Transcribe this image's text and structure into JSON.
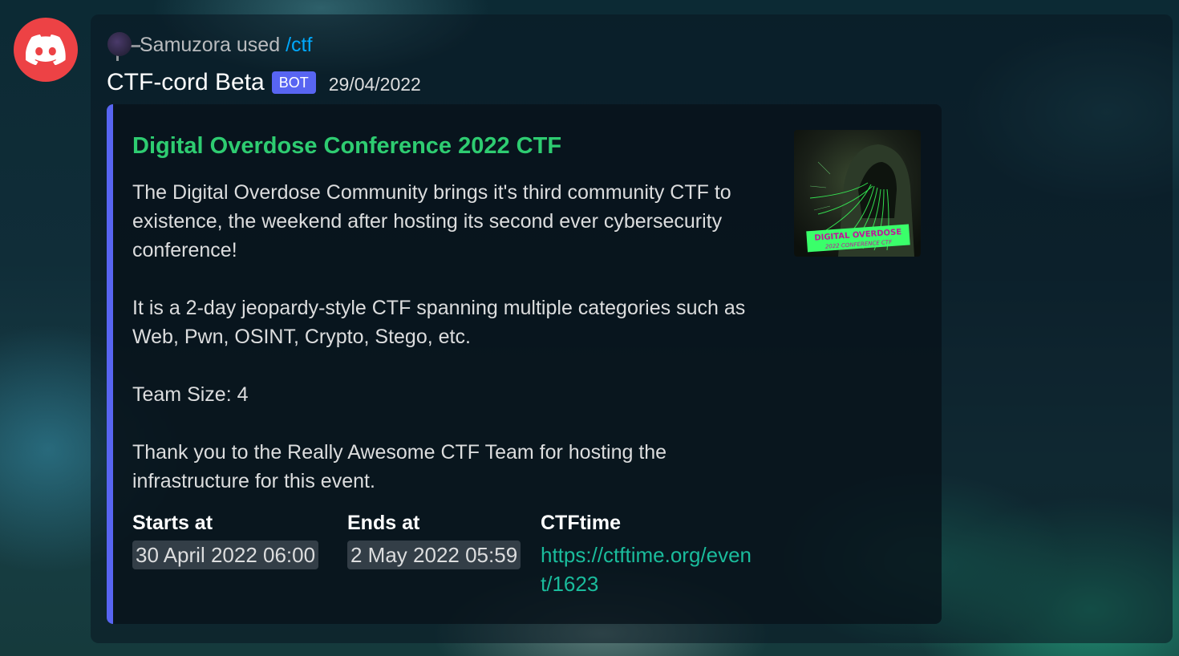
{
  "app": {
    "icon": "discord-logo-icon",
    "accent": "#ed4245"
  },
  "reply": {
    "username": "Samuzora",
    "action": "used",
    "command": "/ctf"
  },
  "message": {
    "author": "CTF-cord Beta",
    "bot_tag": "BOT",
    "timestamp": "29/04/2022"
  },
  "embed": {
    "accent_color": "#5865f2",
    "title": "Digital Overdose Conference 2022 CTF",
    "title_color": "#2ecc71",
    "description": [
      "The Digital Overdose Community brings it's third community CTF to existence, the weekend after hosting its second ever cybersecurity conference!",
      "It is a 2-day jeopardy-style CTF spanning multiple categories such as Web, Pwn, OSINT, Crypto, Stego, etc.",
      "Team Size: 4",
      "Thank you to the Really Awesome CTF Team for hosting the infrastructure for this event."
    ],
    "thumbnail": {
      "line1": "DIGITAL OVERDOSE",
      "line2": "2022 CONFERENCE CTF"
    },
    "fields": [
      {
        "name": "Starts at",
        "value": "30 April 2022 06:00"
      },
      {
        "name": "Ends at",
        "value": "2 May 2022 05:59"
      },
      {
        "name": "CTFtime",
        "value": "https://ctftime.org/event/1623"
      }
    ]
  }
}
